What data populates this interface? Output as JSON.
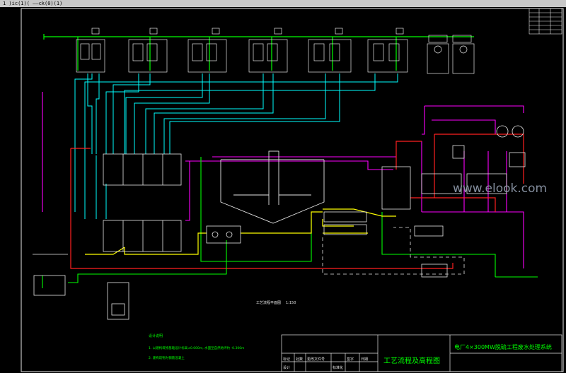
{
  "window": {
    "title_fragment": "1 )ic(1)( ——ck(0)(1)"
  },
  "drawing": {
    "plan_caption": "工艺流程平面图",
    "plan_scale": "1:150",
    "watermark": "www.elook.com",
    "notes_heading": "设计说明",
    "notes": [
      "1. 以建构筑物基础设计标高±0.000m, 水面至自然地坪约 -0.300m",
      "2. 建构筑物为钢筋混凝土"
    ]
  },
  "title_block": {
    "project_title": "电厂4×300MW脱硫工程废水处理系统",
    "drawing_title": "工艺流程及高程图",
    "row_labels": [
      "标记",
      "处数",
      "更改文件号",
      "签字",
      "日期"
    ],
    "row2_labels": [
      "设计",
      "",
      "标准化"
    ]
  },
  "colors": {
    "background": "#000000",
    "green_line": "#00ff00",
    "cyan_line": "#00ffff",
    "magenta_line": "#ff00ff",
    "red_line": "#ff2020",
    "yellow_line": "#ffff00",
    "white_line": "#e6e6e6"
  }
}
